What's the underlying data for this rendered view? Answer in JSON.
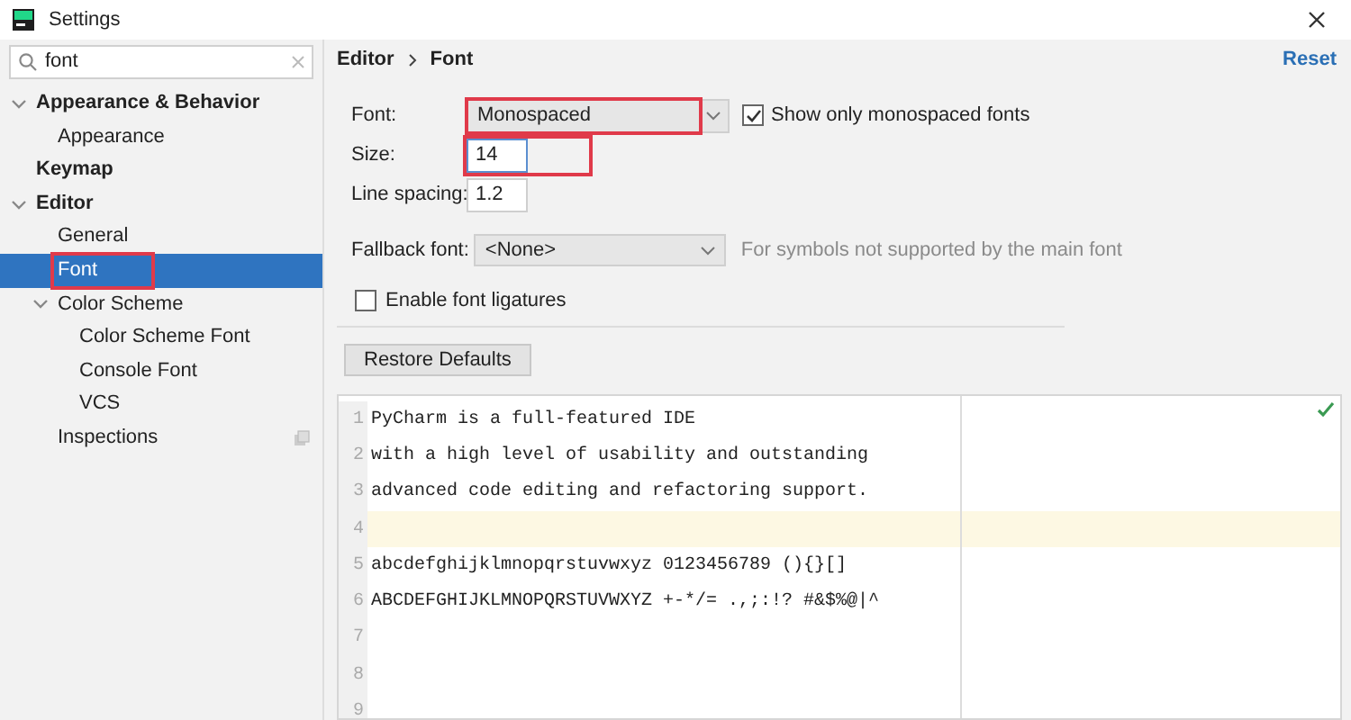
{
  "window": {
    "title": "Settings"
  },
  "search": {
    "value": "font"
  },
  "tree": [
    {
      "label": "Appearance & Behavior",
      "expanded": true,
      "selected": false,
      "highlighted": false,
      "children": [
        {
          "label": "Appearance",
          "selected": false,
          "highlighted": false
        }
      ]
    },
    {
      "label": "Keymap",
      "selected": false,
      "highlighted": false
    },
    {
      "label": "Editor",
      "expanded": true,
      "selected": false,
      "highlighted": false,
      "children": [
        {
          "label": "General",
          "selected": false,
          "highlighted": false
        },
        {
          "label": "Font",
          "selected": true,
          "highlighted": true
        },
        {
          "label": "Color Scheme",
          "expanded": true,
          "selected": false,
          "highlighted": false,
          "children": [
            {
              "label": "Color Scheme Font",
              "selected": false,
              "highlighted": false
            },
            {
              "label": "Console Font",
              "selected": false,
              "highlighted": false
            },
            {
              "label": "VCS",
              "selected": false,
              "highlighted": false
            }
          ]
        },
        {
          "label": "Inspections",
          "selected": false,
          "highlighted": false,
          "project_icon": true
        }
      ]
    }
  ],
  "breadcrumb": [
    "Editor",
    "Font"
  ],
  "reset_link": "Reset",
  "font": {
    "label": "Font:",
    "value": "Monospaced",
    "highlighted": true
  },
  "monospaced_only": {
    "label": "Show only monospaced fonts",
    "checked": true
  },
  "size": {
    "label": "Size:",
    "value": "14",
    "highlighted": true
  },
  "line_spacing": {
    "label": "Line spacing:",
    "value": "1.2"
  },
  "fallback_font": {
    "label": "Fallback font:",
    "value": "<None>",
    "hint": "For symbols not supported by the main font"
  },
  "ligatures": {
    "label": "Enable font ligatures",
    "checked": false
  },
  "restore_button": "Restore Defaults",
  "preview": {
    "lines": [
      {
        "number": "1",
        "text": "PyCharm is a full-featured IDE",
        "current": false
      },
      {
        "number": "2",
        "text": "with a high level of usability and outstanding",
        "current": false
      },
      {
        "number": "3",
        "text": "advanced code editing and refactoring support.",
        "current": false
      },
      {
        "number": "4",
        "current": true
      },
      {
        "number": "5",
        "text": "abcdefghijklmnopqrstuvwxyz 0123456789 (){}[]",
        "current": false
      },
      {
        "number": "6",
        "text": "ABCDEFGHIJKLMNOPQRSTUVWXYZ +-*/= .,;:!? #&$%@|^",
        "current": false
      },
      {
        "number": "7",
        "current": false
      },
      {
        "number": "8",
        "current": false
      },
      {
        "number": "9",
        "current": false
      }
    ]
  }
}
